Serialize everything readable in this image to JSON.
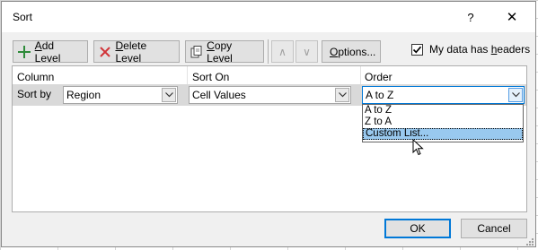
{
  "window": {
    "title": "Sort",
    "help_label": "?",
    "close_label": "✕"
  },
  "toolbar": {
    "add_level_prefix": "",
    "add_level_accel": "A",
    "add_level_rest": "dd Level",
    "delete_level_accel": "D",
    "delete_level_rest": "elete Level",
    "copy_level_accel": "C",
    "copy_level_rest": "opy Level",
    "move_up_glyph": "∧",
    "move_down_glyph": "∨",
    "options_accel": "O",
    "options_rest": "ptions...",
    "headers_checkbox": {
      "checked": true,
      "label_pre": "My data has ",
      "label_accel": "h",
      "label_rest": "eaders"
    }
  },
  "grid": {
    "columns": {
      "column": "Column",
      "sort_on": "Sort On",
      "order": "Order"
    },
    "rows": [
      {
        "label": "Sort by",
        "column_value": "Region",
        "sort_on_value": "Cell Values",
        "order_value": "A to Z"
      }
    ]
  },
  "order_dropdown": {
    "options": [
      "A to Z",
      "Z to A",
      "Custom List..."
    ],
    "highlighted": "Custom List..."
  },
  "footer": {
    "ok_label": "OK",
    "cancel_label": "Cancel"
  },
  "colors": {
    "accent": "#0078d7",
    "highlight": "#99c9ef",
    "row_band": "#d9d9d9",
    "dialog_bg": "#f0f0f0"
  },
  "icons": [
    "plus-icon",
    "delete-x-icon",
    "copy-icon",
    "chevron-up-icon",
    "chevron-down-icon",
    "checkmark-icon",
    "mouse-cursor-icon",
    "resize-grip-icon"
  ]
}
